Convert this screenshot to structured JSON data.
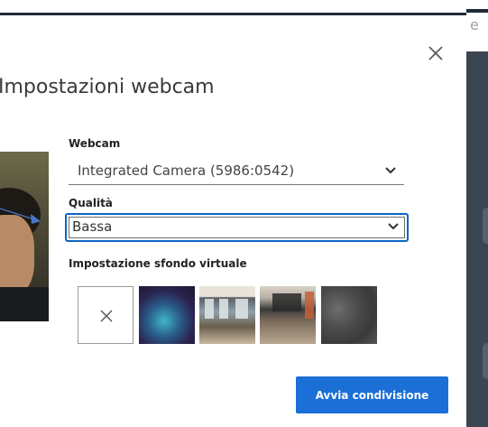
{
  "dialog": {
    "title": "Impostazioni webcam",
    "webcam": {
      "label": "Webcam",
      "selected": "Integrated Camera (5986:0542)"
    },
    "quality": {
      "label": "Qualità",
      "selected": "Bassa"
    },
    "background": {
      "label": "Impostazione sfondo virtuale",
      "options": [
        "none-icon",
        "blur-thumbnail",
        "office-thumbnail-1",
        "office-thumbnail-2",
        "stone-thumbnail"
      ]
    },
    "start_button": "Avvia condivisione"
  },
  "colors": {
    "accent": "#1b6fd6",
    "focus_ring": "#0a66c2",
    "app_dark": "#1f2c38"
  }
}
